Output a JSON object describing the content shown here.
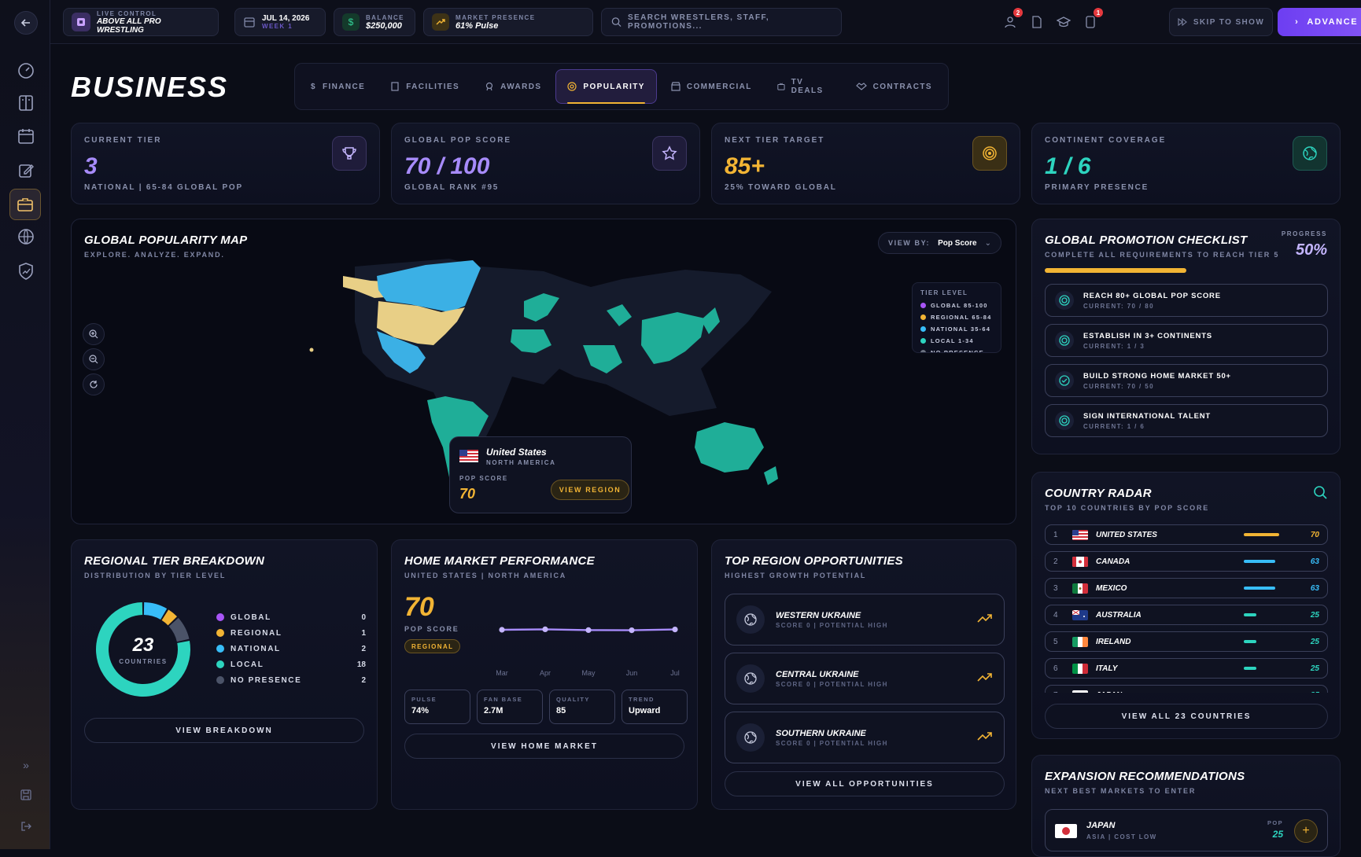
{
  "header": {
    "live_label": "LIVE CONTROL",
    "promotion": "ABOVE ALL PRO WRESTLING",
    "date": "JUL 14, 2026",
    "week": "WEEK 1",
    "balance_label": "BALANCE",
    "balance": "$250,000",
    "market_label": "MARKET PRESENCE",
    "market": "61% Pulse",
    "search_placeholder": "SEARCH WRESTLERS, STAFF, PROMOTIONS...",
    "badge_staff": "2",
    "badge_inbox": "1",
    "skip": "SKIP TO SHOW",
    "advance": "ADVANCE DAY"
  },
  "page": {
    "title": "BUSINESS"
  },
  "tabs": [
    "FINANCE",
    "FACILITIES",
    "AWARDS",
    "POPULARITY",
    "COMMERCIAL",
    "TV DEALS",
    "CONTRACTS"
  ],
  "kpis": [
    {
      "label": "CURRENT TIER",
      "value": "3",
      "sub": "NATIONAL | 65-84 GLOBAL POP",
      "color": "#a78bfa",
      "icon": "trophy-icon"
    },
    {
      "label": "GLOBAL POP SCORE",
      "value": "70 / 100",
      "sub": "GLOBAL RANK #95",
      "color": "#a78bfa",
      "icon": "star-icon"
    },
    {
      "label": "NEXT TIER TARGET",
      "value": "85+",
      "sub": "25% TOWARD GLOBAL",
      "color": "#f2b434",
      "icon": "target-icon"
    },
    {
      "label": "CONTINENT COVERAGE",
      "value": "1 / 6",
      "sub": "PRIMARY PRESENCE",
      "color": "#2dd4bf",
      "icon": "globe-icon"
    }
  ],
  "map": {
    "title": "GLOBAL POPULARITY MAP",
    "subtitle": "EXPLORE. ANALYZE. EXPAND.",
    "view_by_label": "VIEW BY:",
    "view_by_value": "Pop Score",
    "tier_level": "TIER LEVEL",
    "legend": [
      {
        "label": "GLOBAL 85-100",
        "color": "#a855f7"
      },
      {
        "label": "REGIONAL 65-84",
        "color": "#f2b434"
      },
      {
        "label": "NATIONAL 35-64",
        "color": "#38bdf8"
      },
      {
        "label": "LOCAL 1-34",
        "color": "#2dd4bf"
      },
      {
        "label": "NO PRESENCE",
        "color": "#6b7280"
      }
    ],
    "tooltip": {
      "country": "United States",
      "region": "NORTH AMERICA",
      "score_label": "POP SCORE",
      "score": "70",
      "button": "VIEW REGION"
    }
  },
  "checklist": {
    "title": "GLOBAL PROMOTION CHECKLIST",
    "subtitle": "COMPLETE ALL REQUIREMENTS TO REACH TIER 5",
    "progress_label": "PROGRESS",
    "progress": "50%",
    "progress_value": 0.5,
    "items": [
      {
        "title": "REACH 80+ GLOBAL POP SCORE",
        "current": "CURRENT: 70 / 80",
        "done": false
      },
      {
        "title": "ESTABLISH IN 3+ CONTINENTS",
        "current": "CURRENT: 1 / 3",
        "done": false
      },
      {
        "title": "BUILD STRONG HOME MARKET 50+",
        "current": "CURRENT: 70 / 50",
        "done": true
      },
      {
        "title": "SIGN INTERNATIONAL TALENT",
        "current": "CURRENT: 1 / 6",
        "done": false
      }
    ]
  },
  "radar": {
    "title": "COUNTRY RADAR",
    "subtitle": "TOP 10 COUNTRIES BY POP SCORE",
    "rows": [
      {
        "rank": "1",
        "name": "UNITED STATES",
        "score": 70,
        "color": "#f2b434"
      },
      {
        "rank": "2",
        "name": "CANADA",
        "score": 63,
        "color": "#38bdf8"
      },
      {
        "rank": "3",
        "name": "MEXICO",
        "score": 63,
        "color": "#38bdf8"
      },
      {
        "rank": "4",
        "name": "AUSTRALIA",
        "score": 25,
        "color": "#2dd4bf"
      },
      {
        "rank": "5",
        "name": "IRELAND",
        "score": 25,
        "color": "#2dd4bf"
      },
      {
        "rank": "6",
        "name": "ITALY",
        "score": 25,
        "color": "#2dd4bf"
      },
      {
        "rank": "7",
        "name": "JAPAN",
        "score": 25,
        "color": "#2dd4bf"
      }
    ],
    "view_all": "VIEW ALL 23 COUNTRIES"
  },
  "regional": {
    "title": "REGIONAL TIER BREAKDOWN",
    "subtitle": "DISTRIBUTION BY TIER LEVEL",
    "total": "23",
    "total_label": "COUNTRIES",
    "legend": [
      {
        "label": "GLOBAL",
        "count": 0,
        "color": "#a855f7"
      },
      {
        "label": "REGIONAL",
        "count": 1,
        "color": "#f2b434"
      },
      {
        "label": "NATIONAL",
        "count": 2,
        "color": "#38bdf8"
      },
      {
        "label": "LOCAL",
        "count": 18,
        "color": "#2dd4bf"
      },
      {
        "label": "NO PRESENCE",
        "count": 2,
        "color": "#4b5368"
      }
    ],
    "button": "VIEW BREAKDOWN"
  },
  "home": {
    "title": "HOME MARKET PERFORMANCE",
    "subtitle": "UNITED STATES | NORTH AMERICA",
    "score": "70",
    "score_label": "POP SCORE",
    "tier": "REGIONAL",
    "chart_months": [
      "Mar",
      "Apr",
      "May",
      "Jun",
      "Jul"
    ],
    "chart_values": [
      70,
      70.3,
      69.8,
      69.7,
      70.2
    ],
    "metrics": [
      {
        "label": "PULSE",
        "value": "74%"
      },
      {
        "label": "FAN BASE",
        "value": "2.7M"
      },
      {
        "label": "QUALITY",
        "value": "85"
      },
      {
        "label": "TREND",
        "value": "Upward"
      }
    ],
    "button": "VIEW HOME MARKET"
  },
  "opportunities": {
    "title": "TOP REGION OPPORTUNITIES",
    "subtitle": "HIGHEST GROWTH POTENTIAL",
    "items": [
      {
        "name": "WESTERN UKRAINE",
        "meta": "SCORE 0 | POTENTIAL HIGH"
      },
      {
        "name": "CENTRAL UKRAINE",
        "meta": "SCORE 0 | POTENTIAL HIGH"
      },
      {
        "name": "SOUTHERN UKRAINE",
        "meta": "SCORE 0 | POTENTIAL HIGH"
      }
    ],
    "button": "VIEW ALL OPPORTUNITIES"
  },
  "expansion": {
    "title": "EXPANSION RECOMMENDATIONS",
    "subtitle": "NEXT BEST MARKETS TO ENTER",
    "item": {
      "name": "JAPAN",
      "meta": "ASIA | COST LOW",
      "pop_label": "POP",
      "pop": "25"
    }
  },
  "colors": {
    "accent": "#8b5cf6",
    "gold": "#f2b434",
    "teal": "#2dd4bf",
    "blue": "#38bdf8"
  }
}
